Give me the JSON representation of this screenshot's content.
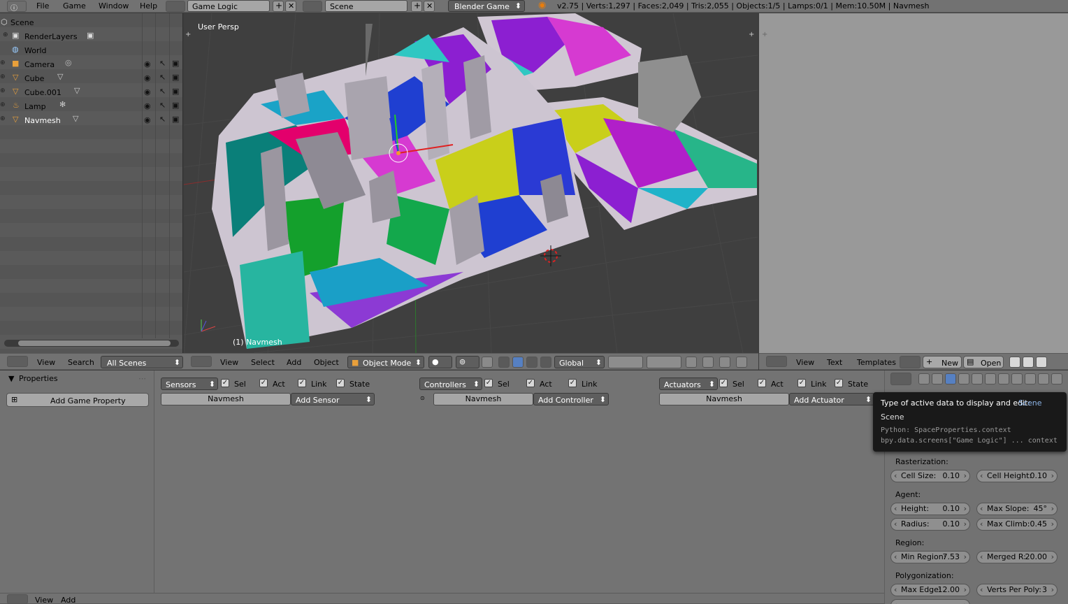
{
  "topbar": {
    "menus": [
      "File",
      "Game",
      "Window",
      "Help"
    ],
    "screen_layout": "Game Logic",
    "scene": "Scene",
    "render_engine": "Blender Game",
    "stats": "v2.75 | Verts:1,297 | Faces:2,049 | Tris:2,055 | Objects:1/5 | Lamps:0/1 | Mem:10.50M | Navmesh"
  },
  "outliner": {
    "items": [
      {
        "label": "Scene"
      },
      {
        "label": "RenderLayers"
      },
      {
        "label": "World"
      },
      {
        "label": "Camera"
      },
      {
        "label": "Cube"
      },
      {
        "label": "Cube.001"
      },
      {
        "label": "Lamp"
      },
      {
        "label": "Navmesh"
      }
    ],
    "footer": {
      "view": "View",
      "search": "Search",
      "filter": "All Scenes"
    }
  },
  "viewport": {
    "label": "User Persp",
    "object_label": "(1) Navmesh",
    "footer": {
      "view": "View",
      "select": "Select",
      "add": "Add",
      "object": "Object",
      "mode": "Object Mode",
      "orientation": "Global"
    },
    "colors": {
      "grid": "#474747",
      "background": "#3f3f3f"
    }
  },
  "text_editor": {
    "footer": {
      "view": "View",
      "text": "Text",
      "templates": "Templates",
      "new": "New",
      "open": "Open"
    }
  },
  "logic": {
    "properties_title": "Properties",
    "add_property": "Add Game Property",
    "sensors": {
      "menu": "Sensors",
      "sel": "Sel",
      "act": "Act",
      "link": "Link",
      "state": "State",
      "object": "Navmesh",
      "add": "Add Sensor"
    },
    "controllers": {
      "menu": "Controllers",
      "sel": "Sel",
      "act": "Act",
      "link": "Link",
      "object": "Navmesh",
      "add": "Add Controller"
    },
    "actuators": {
      "menu": "Actuators",
      "sel": "Sel",
      "act": "Act",
      "link": "Link",
      "state": "State",
      "object": "Navmesh",
      "add": "Add Actuator"
    },
    "footer": {
      "view": "View",
      "add": "Add"
    }
  },
  "tooltip": {
    "title": "Type of active data to display and edit:",
    "title_value": "Scene",
    "line2": "Scene",
    "python1": "Python: SpaceProperties.context",
    "python2": "bpy.data.screens[\"Game Logic\"] ... context"
  },
  "navmesh_props": {
    "rasterization": "Rasterization:",
    "cell_size": {
      "label": "Cell Size:",
      "value": "0.10"
    },
    "cell_height": {
      "label": "Cell Height:",
      "value": "0.10"
    },
    "agent": "Agent:",
    "height": {
      "label": "Height:",
      "value": "0.10"
    },
    "max_slope": {
      "label": "Max Slope:",
      "value": "45°"
    },
    "radius": {
      "label": "Radius:",
      "value": "0.10"
    },
    "max_climb": {
      "label": "Max Climb:",
      "value": "0.45"
    },
    "region": "Region:",
    "min_region": {
      "label": "Min Region:",
      "value": "7.53"
    },
    "merged_r": {
      "label": "Merged R:",
      "value": "20.00"
    },
    "polygonization": "Polygonization:",
    "max_edge": {
      "label": "Max Edge:",
      "value": "12.00"
    },
    "verts_per_poly": {
      "label": "Verts Per Poly:",
      "value": "3"
    }
  }
}
